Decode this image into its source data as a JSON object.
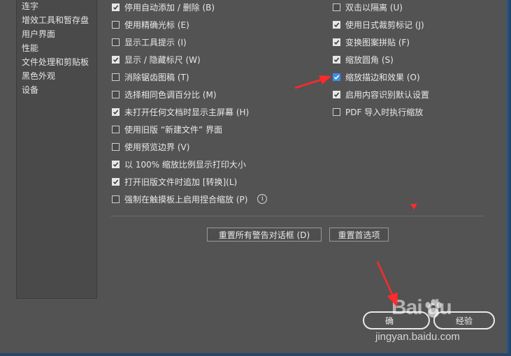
{
  "sidebar": {
    "items": [
      "连字",
      "增效工具和暂存盘",
      "用户界面",
      "性能",
      "文件处理和剪贴板",
      "黑色外观",
      "设备"
    ]
  },
  "options_left": [
    {
      "label": "停用自动添加 / 删除 (B)",
      "checked": true
    },
    {
      "label": "使用精确光标 (E)",
      "checked": false
    },
    {
      "label": "显示工具提示 (I)",
      "checked": false
    },
    {
      "label": "显示 / 隐藏标尺 (W)",
      "checked": true
    },
    {
      "label": "消除锯齿图稿 (T)",
      "checked": false
    },
    {
      "label": "选择相同色调百分比 (M)",
      "checked": false
    },
    {
      "label": "未打开任何文档时显示主屏幕 (H)",
      "checked": true
    },
    {
      "label": "使用旧版 “新建文件” 界面",
      "checked": false
    },
    {
      "label": "使用预览边界 (V)",
      "checked": false
    },
    {
      "label": "以 100% 缩放比例显示打印大小",
      "checked": true
    },
    {
      "label": "打开旧版文件时追加 [转换](L)",
      "checked": true
    },
    {
      "label": "强制在触摸板上启用捏合缩放 (P)",
      "checked": false,
      "info": "i"
    }
  ],
  "options_right": [
    {
      "label": "双击以隔离 (U)",
      "checked": false
    },
    {
      "label": "使用日式裁剪标记 (J)",
      "checked": true
    },
    {
      "label": "变换图案拼贴 (F)",
      "checked": true
    },
    {
      "label": "缩放圆角 (S)",
      "checked": true
    },
    {
      "label": "缩放描边和效果 (O)",
      "checked": true,
      "highlight": true
    },
    {
      "label": "启用内容识别默认设置",
      "checked": true
    },
    {
      "label": "PDF 导入时执行缩放",
      "checked": false
    }
  ],
  "buttons": {
    "reset_warnings": "重置所有警告对话框 (D)",
    "reset_prefs": "重置首选项",
    "ok": "确",
    "cancel": "经验"
  },
  "watermark": {
    "logo": "Bai du",
    "url": "jingyan.baidu.com"
  },
  "colors": {
    "background": "#535353",
    "arrow": "#ff2a2a",
    "checkbox_blue": "#3d8ee8"
  }
}
